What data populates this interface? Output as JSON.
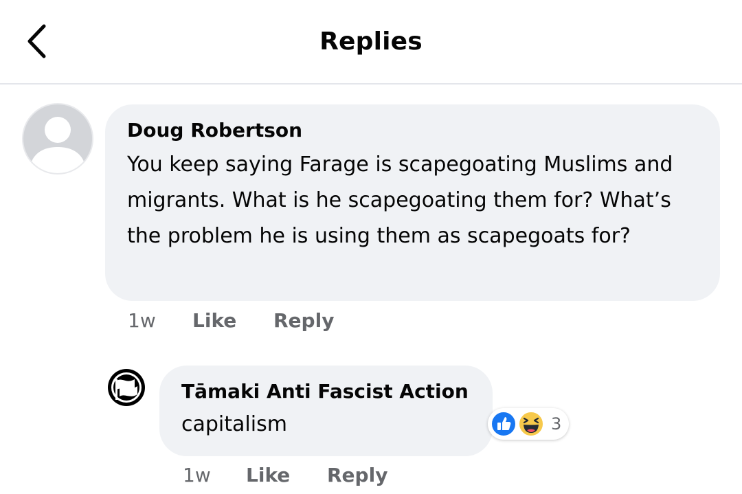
{
  "header": {
    "title": "Replies",
    "back_icon": "chevron-left-icon"
  },
  "comments": [
    {
      "author": "Doug Robertson",
      "avatar_icon": "default-profile-silhouette",
      "text": "You keep saying Farage is scapegoating Muslims and migrants. What is he scapegoating them for? What’s the problem he is using them as scapegoats for?",
      "time": "1w",
      "like_label": "Like",
      "reply_label": "Reply"
    },
    {
      "author": "Tāmaki Anti Fascist Action",
      "avatar_icon": "antifa-flag-logo",
      "text": "capitalism",
      "time": "1w",
      "like_label": "Like",
      "reply_label": "Reply",
      "reactions": {
        "icons": [
          "like-reaction-icon",
          "haha-reaction-icon"
        ],
        "count": "3"
      }
    }
  ],
  "colors": {
    "bubble": "#f0f2f5",
    "meta_text": "#65676b",
    "like_blue": "#1877f2",
    "haha_yellow": "#f7c94b"
  }
}
